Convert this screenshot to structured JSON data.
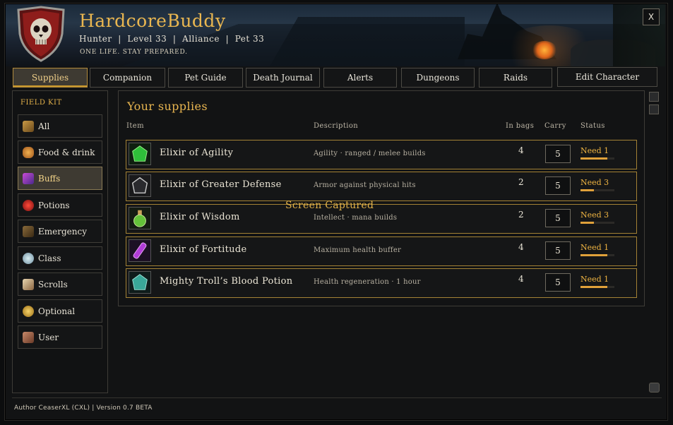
{
  "app": {
    "title": "HardcoreBuddy",
    "subline": "Hunter  |  Level 33  |  Alliance  |  Pet 33",
    "tagline": "ONE LIFE. STAY PREPARED.",
    "close_label": "X"
  },
  "tabs": [
    {
      "label": "Supplies",
      "active": true
    },
    {
      "label": "Companion",
      "active": false
    },
    {
      "label": "Pet Guide",
      "active": false
    },
    {
      "label": "Death Journal",
      "active": false
    },
    {
      "label": "Alerts",
      "active": false
    },
    {
      "label": "Dungeons",
      "active": false
    },
    {
      "label": "Raids",
      "active": false
    },
    {
      "label": "Edit Character",
      "active": false
    }
  ],
  "sidebar": {
    "title": "FIELD KIT",
    "items": [
      {
        "label": "All",
        "icon": "scroll-icon",
        "active": false
      },
      {
        "label": "Food & drink",
        "icon": "bread-icon",
        "active": false
      },
      {
        "label": "Buffs",
        "icon": "buff-icon",
        "active": true
      },
      {
        "label": "Potions",
        "icon": "potion-icon",
        "active": false
      },
      {
        "label": "Emergency",
        "icon": "emergency-icon",
        "active": false
      },
      {
        "label": "Class",
        "icon": "class-icon",
        "active": false
      },
      {
        "label": "Scrolls",
        "icon": "scroll-icon",
        "active": false
      },
      {
        "label": "Optional",
        "icon": "optional-icon",
        "active": false
      },
      {
        "label": "User",
        "icon": "user-icon",
        "active": false
      }
    ]
  },
  "main": {
    "section_title": "Your supplies",
    "columns": {
      "item": "Item",
      "description": "Description",
      "in_bags": "In bags",
      "carry": "Carry",
      "status": "Status"
    },
    "rows": [
      {
        "name": "Elixir of Agility",
        "description": "Agility · ranged / melee builds",
        "in_bags": "4",
        "carry": "5",
        "status": "Need 1",
        "progress": 0.8,
        "icon": "green-elixir-icon",
        "icon_color": "#2fbf3a"
      },
      {
        "name": "Elixir of Greater Defense",
        "description": "Armor against physical hits",
        "in_bags": "2",
        "carry": "5",
        "status": "Need 3",
        "progress": 0.4,
        "icon": "silver-elixir-icon",
        "icon_color": "#9a9a9a"
      },
      {
        "name": "Elixir of Wisdom",
        "description": "Intellect · mana builds",
        "in_bags": "2",
        "carry": "5",
        "status": "Need 3",
        "progress": 0.4,
        "icon": "green-flask-icon",
        "icon_color": "#64c23a"
      },
      {
        "name": "Elixir of Fortitude",
        "description": "Maximum health buffer",
        "in_bags": "4",
        "carry": "5",
        "status": "Need 1",
        "progress": 0.8,
        "icon": "purple-vial-icon",
        "icon_color": "#b23cd9"
      },
      {
        "name": "Mighty Troll’s Blood Potion",
        "description": "Health regeneration · 1 hour",
        "in_bags": "4",
        "carry": "5",
        "status": "Need 1",
        "progress": 0.8,
        "icon": "teal-potion-icon",
        "icon_color": "#3aa899"
      }
    ],
    "overlay_text": "Screen Captured"
  },
  "footer": {
    "text": "Author CeaserXL (CXL) | Version 0.7 BETA"
  },
  "colors": {
    "accent": "#e9b650",
    "active_tab_bg": "#3e3a32",
    "row_border": "#a48235"
  }
}
